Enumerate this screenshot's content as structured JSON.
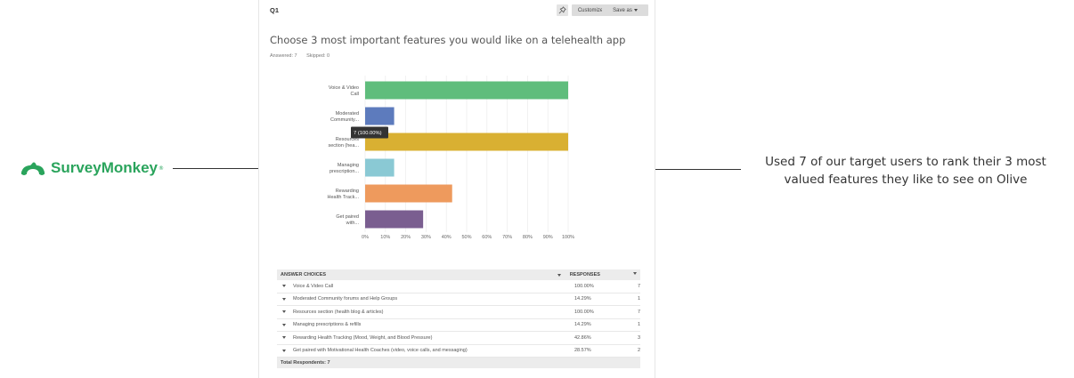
{
  "logo": {
    "name": "SurveyMonkey",
    "brand_color": "#2aa45c"
  },
  "caption": "Used 7 of our target users to rank their 3 most valued features they like to see on Olive",
  "survey": {
    "question_number": "Q1",
    "toolbar": {
      "customize_label": "Customize",
      "save_as_label": "Save as"
    },
    "question_title": "Choose 3 most important features you would like on a telehealth app",
    "answered_label": "Answered: 7",
    "skipped_label": "Skipped: 0",
    "tooltip": "7 (100.00%)"
  },
  "chart_data": {
    "type": "bar",
    "orientation": "horizontal",
    "categories": [
      [
        "Voice & Video",
        "Call"
      ],
      [
        "Moderated",
        "Community..."
      ],
      [
        "Resources",
        "section (hea..."
      ],
      [
        "Managing",
        "prescription..."
      ],
      [
        "Rewarding",
        "Health Track..."
      ],
      [
        "Get paired",
        "with..."
      ]
    ],
    "values": [
      100,
      14.29,
      100,
      14.29,
      42.86,
      28.57
    ],
    "colors": [
      "#5fbd7c",
      "#5d7bbd",
      "#d9b032",
      "#8ac9d4",
      "#ee9a5d",
      "#7a5e90"
    ],
    "x_ticks": [
      "0%",
      "10%",
      "20%",
      "30%",
      "40%",
      "50%",
      "60%",
      "70%",
      "80%",
      "90%",
      "100%"
    ],
    "xlim": [
      0,
      100
    ],
    "grid": true
  },
  "table": {
    "headers": {
      "choice": "ANSWER CHOICES",
      "responses": "RESPONSES"
    },
    "rows": [
      {
        "choice": "Voice & Video Call",
        "pct": "100.00%",
        "count": "7"
      },
      {
        "choice": "Moderated Community forums and Help Groups",
        "pct": "14.29%",
        "count": "1"
      },
      {
        "choice": "Resources section (health blog & articles)",
        "pct": "100.00%",
        "count": "7"
      },
      {
        "choice": "Managing prescriptions & refills",
        "pct": "14.29%",
        "count": "1"
      },
      {
        "choice": "Rewarding Health Tracking (Mood, Weight, and Blood Pressure)",
        "pct": "42.86%",
        "count": "3"
      },
      {
        "choice": "Get paired with Motivational Health Coaches (video, voice calls, and messaging)",
        "pct": "28.57%",
        "count": "2"
      }
    ],
    "total_label": "Total Respondents: 7"
  }
}
